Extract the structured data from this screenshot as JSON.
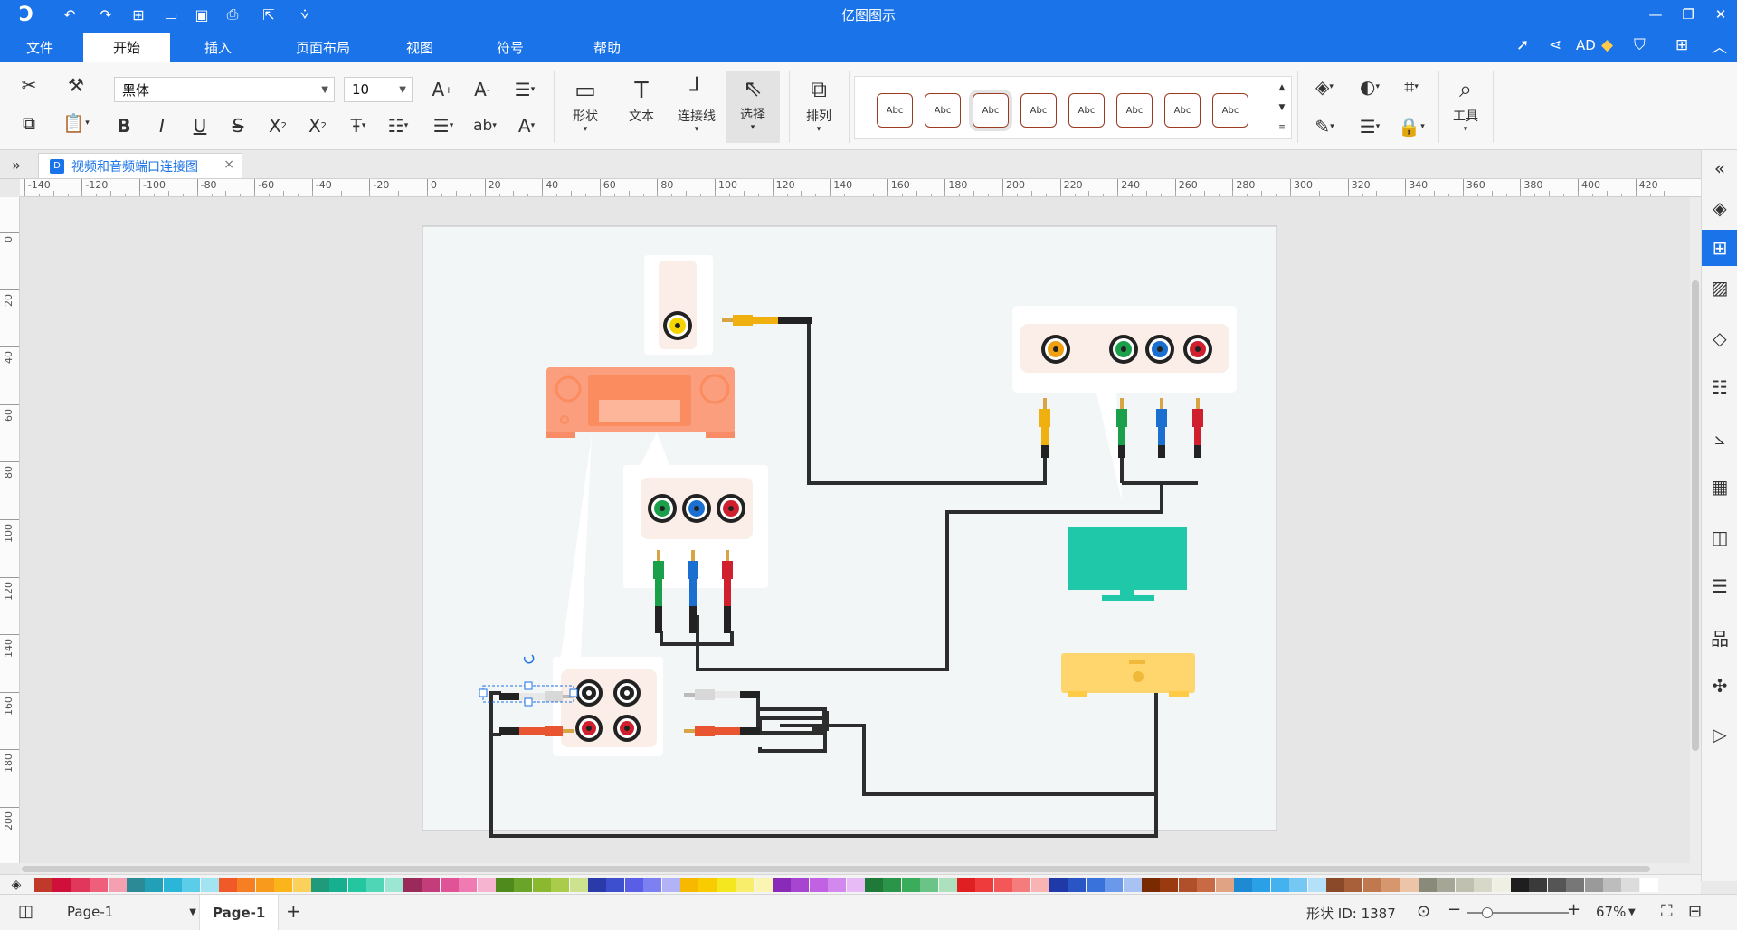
{
  "app": {
    "title": "亿图图示"
  },
  "quick_access": [
    {
      "name": "logo-icon",
      "glyph": "Ↄ"
    },
    {
      "name": "undo-icon",
      "glyph": "↶"
    },
    {
      "name": "redo-icon",
      "glyph": "↷"
    },
    {
      "name": "new-file-icon",
      "glyph": "⊞"
    },
    {
      "name": "open-folder-icon",
      "glyph": "▭"
    },
    {
      "name": "save-icon",
      "glyph": "▣"
    },
    {
      "name": "print-icon",
      "glyph": "⎙"
    },
    {
      "name": "export-icon",
      "glyph": "⇱"
    },
    {
      "name": "customize-icon",
      "glyph": "⩒"
    }
  ],
  "window_controls": [
    {
      "name": "minimize-icon",
      "glyph": "—"
    },
    {
      "name": "restore-icon",
      "glyph": "❐"
    },
    {
      "name": "close-icon",
      "glyph": "✕"
    }
  ],
  "menu_tabs": [
    "文件",
    "开始",
    "插入",
    "页面布局",
    "视图",
    "符号",
    "帮助"
  ],
  "active_menu": "开始",
  "header_right": {
    "user_initials": "AD"
  },
  "ribbon": {
    "font_family": "黑体",
    "font_size": "10",
    "large_buttons": [
      "形状",
      "文本",
      "连接线",
      "选择",
      "排列",
      "工具"
    ],
    "style_swatches": [
      "Abc",
      "Abc",
      "Abc",
      "Abc",
      "Abc",
      "Abc",
      "Abc",
      "Abc"
    ],
    "selected_style_index": 2
  },
  "document_tab": {
    "title": "视频和音频端口连接图"
  },
  "ruler": {
    "h_labels": [
      "-140",
      "-120",
      "-100",
      "-80",
      "-60",
      "-40",
      "-20",
      "0",
      "20",
      "40",
      "60",
      "80",
      "100",
      "120",
      "140",
      "160",
      "180",
      "200",
      "220",
      "240",
      "260",
      "280",
      "300",
      "320",
      "340",
      "360",
      "380",
      "400",
      "420"
    ],
    "v_labels": [
      "0",
      "20",
      "40",
      "60",
      "80",
      "100",
      "120",
      "140",
      "160",
      "180",
      "200"
    ]
  },
  "palette_colors": [
    "#c0392b",
    "#d0103a",
    "#e0375b",
    "#ef5f7b",
    "#f4a0b0",
    "#2c8a96",
    "#22a0b8",
    "#2bb5d8",
    "#5ccde8",
    "#a2e4f2",
    "#f05a28",
    "#f57f22",
    "#f89a1c",
    "#fbb419",
    "#fcd15b",
    "#1f9a7a",
    "#16b090",
    "#24c6a0",
    "#4fd6b7",
    "#9ce6d4",
    "#9a2a5a",
    "#c23d7a",
    "#e05497",
    "#f07ab2",
    "#f6b4d0",
    "#4f8a1c",
    "#6aa52a",
    "#8ab82e",
    "#a9cc4b",
    "#cde28e",
    "#2a3aa8",
    "#3d4ecf",
    "#5a5ee6",
    "#7c80f0",
    "#b1b3f6",
    "#f6b900",
    "#f8cc00",
    "#f4e61f",
    "#f8ee6c",
    "#fbf5b4",
    "#8a2ab8",
    "#a845d0",
    "#c062e2",
    "#d388ee",
    "#e7bcf6",
    "#1f7a3a",
    "#2a9448",
    "#3aac5c",
    "#6ac487",
    "#ade0bd",
    "#e02020",
    "#ef3b3b",
    "#f35757",
    "#f57c7c",
    "#f9b3b3",
    "#1f3aa8",
    "#2a55c4",
    "#3a72dc",
    "#6a98ea",
    "#a8c2f4",
    "#7a2a00",
    "#9a3a10",
    "#b0502a",
    "#c86a44",
    "#e0a384",
    "#1f8ad4",
    "#2aa0e6",
    "#45b2f0",
    "#76c8f4",
    "#b5e0fa",
    "#8a4a2a",
    "#a8603a",
    "#c0784e",
    "#d6966e",
    "#ecc4a8",
    "#8a8a7a",
    "#a6a696",
    "#c0c0b0",
    "#d8d8c8",
    "#efefe4",
    "#1e1e1e",
    "#3a3a3a",
    "#555555",
    "#777777",
    "#9a9a9a",
    "#bdbdbd",
    "#dcdcdc",
    "#ffffff"
  ],
  "status": {
    "page_selector": "Page-1",
    "current_page": "Page-1",
    "shape_id_label": "形状 ID:",
    "shape_id": "1387",
    "zoom": "67%"
  }
}
